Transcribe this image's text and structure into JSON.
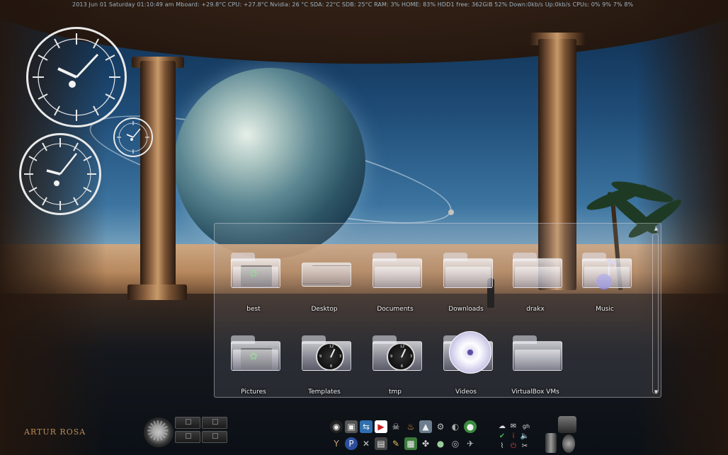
{
  "statusbar": {
    "text": "2013 Jun 01  Saturday 01:10:49 am Mboard:  +29.8°C CPU:  +27.8°C Nvidia: 26 °C SDA:  22°C SDB:  25°C  RAM: 3%  HOME: 83%  HDD1 free: 362GiB 52% Down:0kb/s  Up:0kb/s  CPUs: 0% 9% 7% 8%"
  },
  "wallpaper": {
    "signature": "ARTUR ROSA"
  },
  "folderview": {
    "items": [
      {
        "label": "best",
        "icon": "folder-with-image-badge-icon"
      },
      {
        "label": "Desktop",
        "icon": "desktop-folder-icon"
      },
      {
        "label": "Documents",
        "icon": "folder-icon"
      },
      {
        "label": "Downloads",
        "icon": "folder-icon"
      },
      {
        "label": "drakx",
        "icon": "folder-icon"
      },
      {
        "label": "Music",
        "icon": "music-folder-icon"
      },
      {
        "label": "Pictures",
        "icon": "folder-with-image-badge-icon"
      },
      {
        "label": "Templates",
        "icon": "folder-with-clock-icon"
      },
      {
        "label": "tmp",
        "icon": "folder-with-clock-icon"
      },
      {
        "label": "Videos",
        "icon": "video-disc-folder-icon"
      },
      {
        "label": "VirtualBox VMs",
        "icon": "folder-icon"
      }
    ]
  },
  "clocks": [
    {
      "name": "large-clock",
      "clockbadge_numbers": []
    },
    {
      "name": "small-clock"
    },
    {
      "name": "medium-clock"
    }
  ],
  "clockbadge": {
    "n12": "12",
    "n3": "3",
    "n6": "6",
    "n9": "9"
  },
  "dock": {
    "gear_icon": "gear-icon",
    "launcher_icons": [
      "app-icon-1",
      "app-icon-2",
      "app-icon-3",
      "app-icon-4",
      "app-icon-5",
      "app-icon-6",
      "app-icon-7",
      "app-icon-8",
      "app-icon-9",
      "app-icon-10",
      "app-icon-11",
      "app-icon-12",
      "app-icon-13",
      "app-icon-14",
      "app-icon-15",
      "app-icon-16",
      "app-icon-17",
      "app-icon-18",
      "app-icon-19",
      "app-icon-20"
    ],
    "tray_label": "gh"
  }
}
